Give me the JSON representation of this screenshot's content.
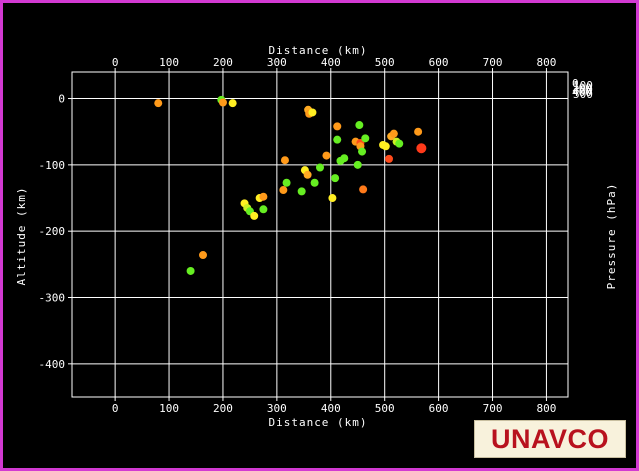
{
  "chart_data": {
    "type": "scatter",
    "title": "",
    "xlabel": "Distance (km)",
    "ylabel": "Altitude (km)",
    "y2label": "Pressure (hPa)",
    "xlim": [
      -80,
      840
    ],
    "ylim": [
      -450,
      40
    ],
    "xticks": [
      0,
      100,
      200,
      300,
      400,
      500,
      600,
      700,
      800
    ],
    "yticks": [
      0,
      -100,
      -200,
      -300,
      -400
    ],
    "y2_tick_labels_overlapping": [
      "0",
      "100",
      "200",
      "300",
      "400",
      "500"
    ],
    "grid": true,
    "legend": "none",
    "colors": {
      "background": "#000000",
      "border": "#d23ad2",
      "grid": "#ffffff",
      "text": "#ffffff"
    },
    "points": [
      {
        "x": 80,
        "y": -7,
        "color": "#ff9a1a"
      },
      {
        "x": 197,
        "y": -2,
        "color": "#66ee22"
      },
      {
        "x": 200,
        "y": -6,
        "color": "#ff9a1a"
      },
      {
        "x": 218,
        "y": -7,
        "color": "#ffee22"
      },
      {
        "x": 140,
        "y": -260,
        "color": "#66ee22"
      },
      {
        "x": 163,
        "y": -236,
        "color": "#ff9a1a"
      },
      {
        "x": 240,
        "y": -158,
        "color": "#ffee22"
      },
      {
        "x": 245,
        "y": -165,
        "color": "#ccee22"
      },
      {
        "x": 250,
        "y": -170,
        "color": "#66ee22"
      },
      {
        "x": 258,
        "y": -177,
        "color": "#ffee22"
      },
      {
        "x": 268,
        "y": -150,
        "color": "#ffee22"
      },
      {
        "x": 275,
        "y": -148,
        "color": "#ff9a1a"
      },
      {
        "x": 275,
        "y": -167,
        "color": "#66ee22"
      },
      {
        "x": 312,
        "y": -138,
        "color": "#ff9a1a"
      },
      {
        "x": 315,
        "y": -93,
        "color": "#ff9a1a"
      },
      {
        "x": 318,
        "y": -127,
        "color": "#66ee22"
      },
      {
        "x": 346,
        "y": -140,
        "color": "#66ee22"
      },
      {
        "x": 352,
        "y": -108,
        "color": "#ffee22"
      },
      {
        "x": 357,
        "y": -115,
        "color": "#ffaa22"
      },
      {
        "x": 358,
        "y": -17,
        "color": "#ffaa22"
      },
      {
        "x": 360,
        "y": -23,
        "color": "#ff9a1a"
      },
      {
        "x": 366,
        "y": -21,
        "color": "#ffee22"
      },
      {
        "x": 370,
        "y": -127,
        "color": "#66ee22"
      },
      {
        "x": 380,
        "y": -104,
        "color": "#66ee22"
      },
      {
        "x": 392,
        "y": -86,
        "color": "#ff9a1a"
      },
      {
        "x": 403,
        "y": -150,
        "color": "#ffee22"
      },
      {
        "x": 408,
        "y": -120,
        "color": "#66ee22"
      },
      {
        "x": 412,
        "y": -42,
        "color": "#ff9a1a"
      },
      {
        "x": 412,
        "y": -62,
        "color": "#66ee22"
      },
      {
        "x": 418,
        "y": -94,
        "color": "#66ee22"
      },
      {
        "x": 425,
        "y": -90,
        "color": "#66ee22"
      },
      {
        "x": 446,
        "y": -65,
        "color": "#ff9a1a"
      },
      {
        "x": 450,
        "y": -100,
        "color": "#66ee22"
      },
      {
        "x": 453,
        "y": -40,
        "color": "#66ee22"
      },
      {
        "x": 455,
        "y": -67,
        "color": "#ff4a1a"
      },
      {
        "x": 455,
        "y": -72,
        "color": "#ff9a1a"
      },
      {
        "x": 458,
        "y": -80,
        "color": "#66ee22"
      },
      {
        "x": 460,
        "y": -137,
        "color": "#ff7a1a"
      },
      {
        "x": 464,
        "y": -60,
        "color": "#66ee22"
      },
      {
        "x": 497,
        "y": -70,
        "color": "#ffee22"
      },
      {
        "x": 502,
        "y": -72,
        "color": "#ffee22"
      },
      {
        "x": 508,
        "y": -91,
        "color": "#ff4a1a"
      },
      {
        "x": 512,
        "y": -57,
        "color": "#ffaa22"
      },
      {
        "x": 517,
        "y": -53,
        "color": "#ff9a1a"
      },
      {
        "x": 522,
        "y": -65,
        "color": "#ccee22"
      },
      {
        "x": 527,
        "y": -68,
        "color": "#66ee22"
      },
      {
        "x": 562,
        "y": -50,
        "color": "#ff9a1a"
      },
      {
        "x": 568,
        "y": -75,
        "color": "#ff3a1a",
        "size": "large"
      }
    ]
  },
  "logo": {
    "text": "UNAVCO"
  }
}
